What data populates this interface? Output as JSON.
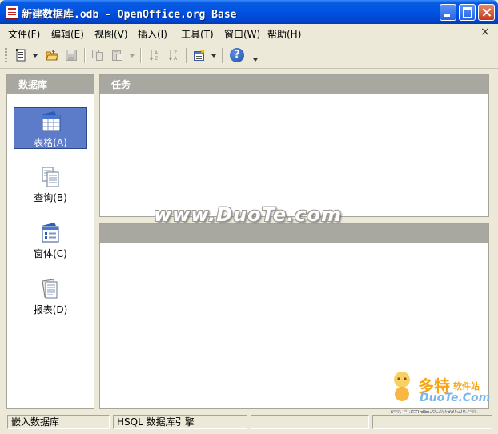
{
  "window": {
    "title": "新建数据库.odb - OpenOffice.org Base"
  },
  "menu": {
    "items": [
      {
        "label": "文件(F)"
      },
      {
        "label": "编辑(E)"
      },
      {
        "label": "视图(V)"
      },
      {
        "label": "插入(I)"
      },
      {
        "label": "工具(T)"
      },
      {
        "label": "窗口(W)"
      },
      {
        "label": "帮助(H)"
      }
    ],
    "close_glyph": "×"
  },
  "toolbar": {
    "icons": [
      "new-document-icon",
      "open-folder-icon",
      "save-icon",
      "copy-icon",
      "paste-icon",
      "sort-ascending-icon",
      "sort-descending-icon",
      "form-wizard-icon",
      "help-icon"
    ],
    "help_glyph": "?"
  },
  "sidebar": {
    "header": "数据库",
    "items": [
      {
        "label": "表格(A)",
        "icon": "table-icon",
        "selected": true
      },
      {
        "label": "查询(B)",
        "icon": "query-icon",
        "selected": false
      },
      {
        "label": "窗体(C)",
        "icon": "form-icon",
        "selected": false
      },
      {
        "label": "报表(D)",
        "icon": "report-icon",
        "selected": false
      }
    ]
  },
  "tasks": {
    "header": "任务"
  },
  "preview": {
    "header": ""
  },
  "watermark": {
    "text": "www.DuoTe.com",
    "logo_cn": "多特",
    "logo_sub": "软件站",
    "logo_en": "DuoTe.Com",
    "slogan": "国内最安全的软件站"
  },
  "status": {
    "cells": [
      "嵌入数据库",
      "HSQL 数据库引擎",
      "",
      ""
    ]
  },
  "colors": {
    "titlebar": "#0054E3",
    "selected_item": "#5C7CC9",
    "panel_header": "#A8A8A0",
    "window_bg": "#ECE9D8"
  }
}
